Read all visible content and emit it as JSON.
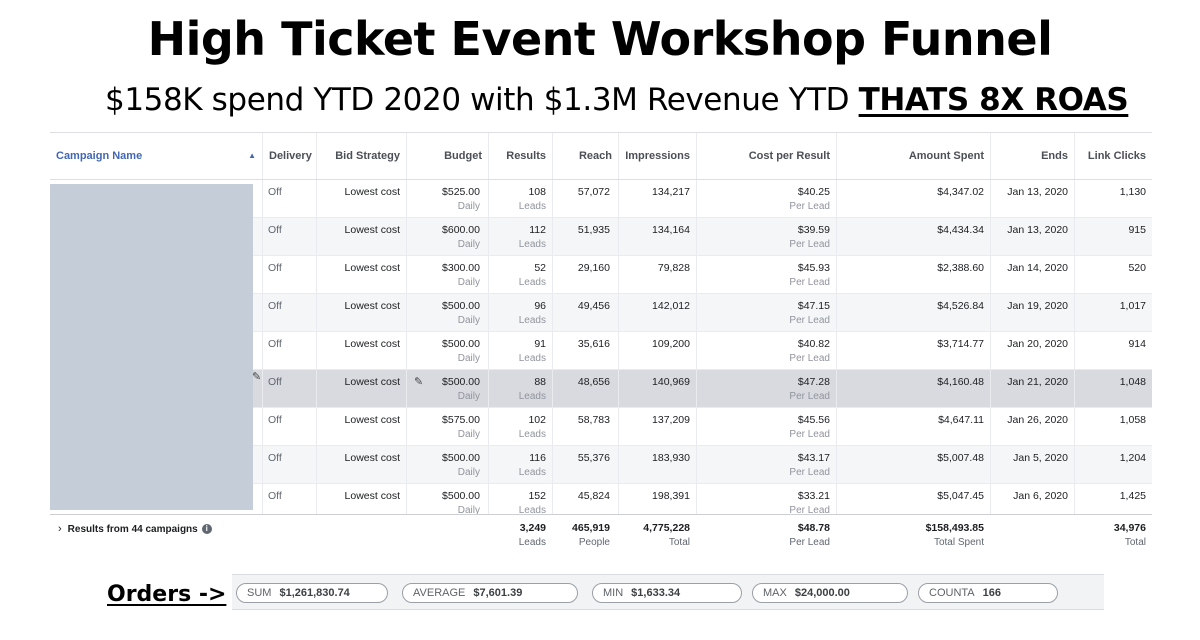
{
  "headline": {
    "title": "High Ticket Event Workshop Funnel",
    "subtitle_main": "$158K spend YTD 2020 with $1.3M Revenue YTD ",
    "subtitle_emph": "THATS 8X ROAS"
  },
  "table": {
    "columns": {
      "campaign_name": "Campaign Name",
      "delivery": "Delivery",
      "bid_strategy": "Bid Strategy",
      "budget": "Budget",
      "results": "Results",
      "reach": "Reach",
      "impressions": "Impressions",
      "cost_per_result": "Cost per Result",
      "amount_spent": "Amount Spent",
      "ends": "Ends",
      "link_clicks": "Link Clicks"
    },
    "rows": [
      {
        "delivery": "Off",
        "bid": "Lowest cost",
        "budget": "$525.00",
        "budget_sub": "Daily",
        "results": "108",
        "results_sub": "Leads",
        "reach": "57,072",
        "impressions": "134,217",
        "cpr": "$40.25",
        "cpr_sub": "Per Lead",
        "spent": "$4,347.02",
        "ends": "Jan 13, 2020",
        "clicks": "1,130"
      },
      {
        "delivery": "Off",
        "bid": "Lowest cost",
        "budget": "$600.00",
        "budget_sub": "Daily",
        "results": "112",
        "results_sub": "Leads",
        "reach": "51,935",
        "impressions": "134,164",
        "cpr": "$39.59",
        "cpr_sub": "Per Lead",
        "spent": "$4,434.34",
        "ends": "Jan 13, 2020",
        "clicks": "915"
      },
      {
        "delivery": "Off",
        "bid": "Lowest cost",
        "budget": "$300.00",
        "budget_sub": "Daily",
        "results": "52",
        "results_sub": "Leads",
        "reach": "29,160",
        "impressions": "79,828",
        "cpr": "$45.93",
        "cpr_sub": "Per Lead",
        "spent": "$2,388.60",
        "ends": "Jan 14, 2020",
        "clicks": "520"
      },
      {
        "delivery": "Off",
        "bid": "Lowest cost",
        "budget": "$500.00",
        "budget_sub": "Daily",
        "results": "96",
        "results_sub": "Leads",
        "reach": "49,456",
        "impressions": "142,012",
        "cpr": "$47.15",
        "cpr_sub": "Per Lead",
        "spent": "$4,526.84",
        "ends": "Jan 19, 2020",
        "clicks": "1,017"
      },
      {
        "delivery": "Off",
        "bid": "Lowest cost",
        "budget": "$500.00",
        "budget_sub": "Daily",
        "results": "91",
        "results_sub": "Leads",
        "reach": "35,616",
        "impressions": "109,200",
        "cpr": "$40.82",
        "cpr_sub": "Per Lead",
        "spent": "$3,714.77",
        "ends": "Jan 20, 2020",
        "clicks": "914"
      },
      {
        "delivery": "Off",
        "bid": "Lowest cost",
        "budget": "$500.00",
        "budget_sub": "Daily",
        "results": "88",
        "results_sub": "Leads",
        "reach": "48,656",
        "impressions": "140,969",
        "cpr": "$47.28",
        "cpr_sub": "Per Lead",
        "spent": "$4,160.48",
        "ends": "Jan 21, 2020",
        "clicks": "1,048"
      },
      {
        "delivery": "Off",
        "bid": "Lowest cost",
        "budget": "$575.00",
        "budget_sub": "Daily",
        "results": "102",
        "results_sub": "Leads",
        "reach": "58,783",
        "impressions": "137,209",
        "cpr": "$45.56",
        "cpr_sub": "Per Lead",
        "spent": "$4,647.11",
        "ends": "Jan 26, 2020",
        "clicks": "1,058"
      },
      {
        "delivery": "Off",
        "bid": "Lowest cost",
        "budget": "$500.00",
        "budget_sub": "Daily",
        "results": "116",
        "results_sub": "Leads",
        "reach": "55,376",
        "impressions": "183,930",
        "cpr": "$43.17",
        "cpr_sub": "Per Lead",
        "spent": "$5,007.48",
        "ends": "Jan 5, 2020",
        "clicks": "1,204"
      },
      {
        "delivery": "Off",
        "bid": "Lowest cost",
        "budget": "$500.00",
        "budget_sub": "Daily",
        "results": "152",
        "results_sub": "Leads",
        "reach": "45,824",
        "impressions": "198,391",
        "cpr": "$33.21",
        "cpr_sub": "Per Lead",
        "spent": "$5,047.45",
        "ends": "Jan 6, 2020",
        "clicks": "1,425"
      }
    ],
    "highlighted_row": 5,
    "footer": {
      "label": "Results from 44 campaigns",
      "results": "3,249",
      "results_sub": "Leads",
      "reach": "465,919",
      "reach_sub": "People",
      "impressions": "4,775,228",
      "impressions_sub": "Total",
      "cpr": "$48.78",
      "cpr_sub": "Per Lead",
      "spent": "$158,493.85",
      "spent_sub": "Total Spent",
      "clicks": "34,976",
      "clicks_sub": "Total"
    }
  },
  "orders": {
    "label": "Orders ->",
    "stats": [
      {
        "key": "SUM",
        "value": "$1,261,830.74"
      },
      {
        "key": "AVERAGE",
        "value": "$7,601.39"
      },
      {
        "key": "MIN",
        "value": "$1,633.34"
      },
      {
        "key": "MAX",
        "value": "$24,000.00"
      },
      {
        "key": "COUNTA",
        "value": "166"
      }
    ]
  },
  "colors": {
    "link_blue": "#4267b2",
    "highlight_row": "#d8dadf",
    "name_redaction": "#c5cdd9"
  },
  "icons": {
    "sort": "caret-up-icon",
    "edit": "pencil-icon",
    "expand": "chevron-right-icon",
    "info": "info-icon"
  }
}
